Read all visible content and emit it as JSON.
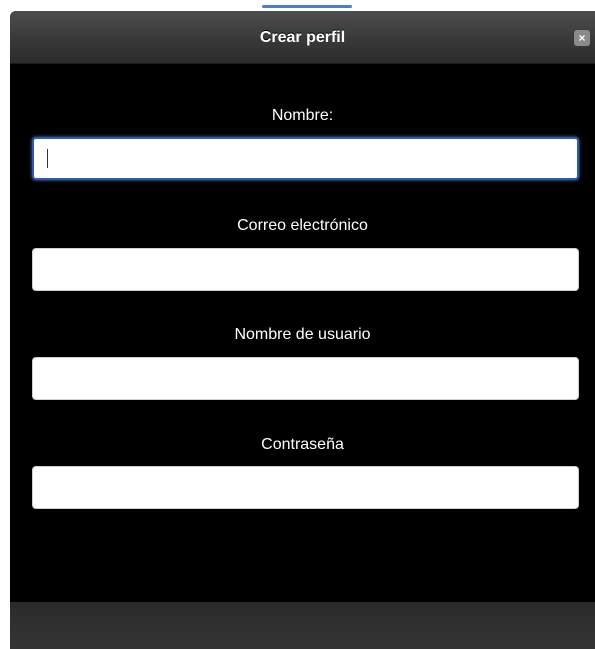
{
  "dialog": {
    "title": "Crear perfil",
    "close_icon": "×"
  },
  "form": {
    "fields": [
      {
        "label": "Nombre:",
        "value": "",
        "placeholder": ""
      },
      {
        "label": "Correo electrónico",
        "value": "",
        "placeholder": ""
      },
      {
        "label": "Nombre de usuario",
        "value": "",
        "placeholder": ""
      },
      {
        "label": "Contraseña",
        "value": "",
        "placeholder": ""
      }
    ]
  },
  "colors": {
    "dialog_background": "#000000",
    "focus_border": "#2d5ba8"
  }
}
